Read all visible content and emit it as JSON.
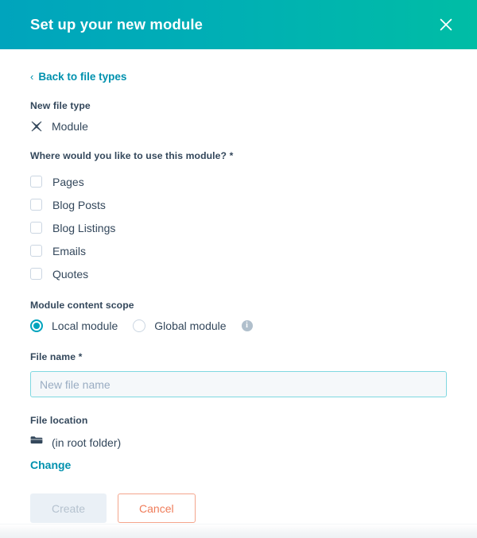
{
  "header": {
    "title": "Set up your new module",
    "close_icon": "close-icon",
    "gradient_start": "#00A4BD",
    "gradient_end": "#00BDA5"
  },
  "back_link": {
    "chevron": "‹",
    "label": "Back to file types"
  },
  "file_type": {
    "label": "New file type",
    "icon": "module-icon",
    "value": "Module"
  },
  "usage": {
    "label": "Where would you like to use this module? *",
    "options": [
      {
        "label": "Pages",
        "checked": false
      },
      {
        "label": "Blog Posts",
        "checked": false
      },
      {
        "label": "Blog Listings",
        "checked": false
      },
      {
        "label": "Emails",
        "checked": false
      },
      {
        "label": "Quotes",
        "checked": false
      }
    ]
  },
  "scope": {
    "label": "Module content scope",
    "options": [
      {
        "label": "Local module",
        "selected": true
      },
      {
        "label": "Global module",
        "selected": false
      }
    ],
    "info_icon": "info-icon",
    "info_glyph": "i"
  },
  "file_name": {
    "label": "File name *",
    "value": "",
    "placeholder": "New file name",
    "focus_border": "#7fd8e0"
  },
  "file_location": {
    "label": "File location",
    "icon": "folder-icon",
    "value": "(in root folder)",
    "change_label": "Change"
  },
  "buttons": {
    "create_label": "Create",
    "create_disabled": true,
    "cancel_label": "Cancel",
    "cancel_color": "#ef7c5a"
  },
  "colors": {
    "link": "#0091AE",
    "text": "#33475b",
    "accent": "#00A4BD",
    "border": "#cbd6e2"
  }
}
